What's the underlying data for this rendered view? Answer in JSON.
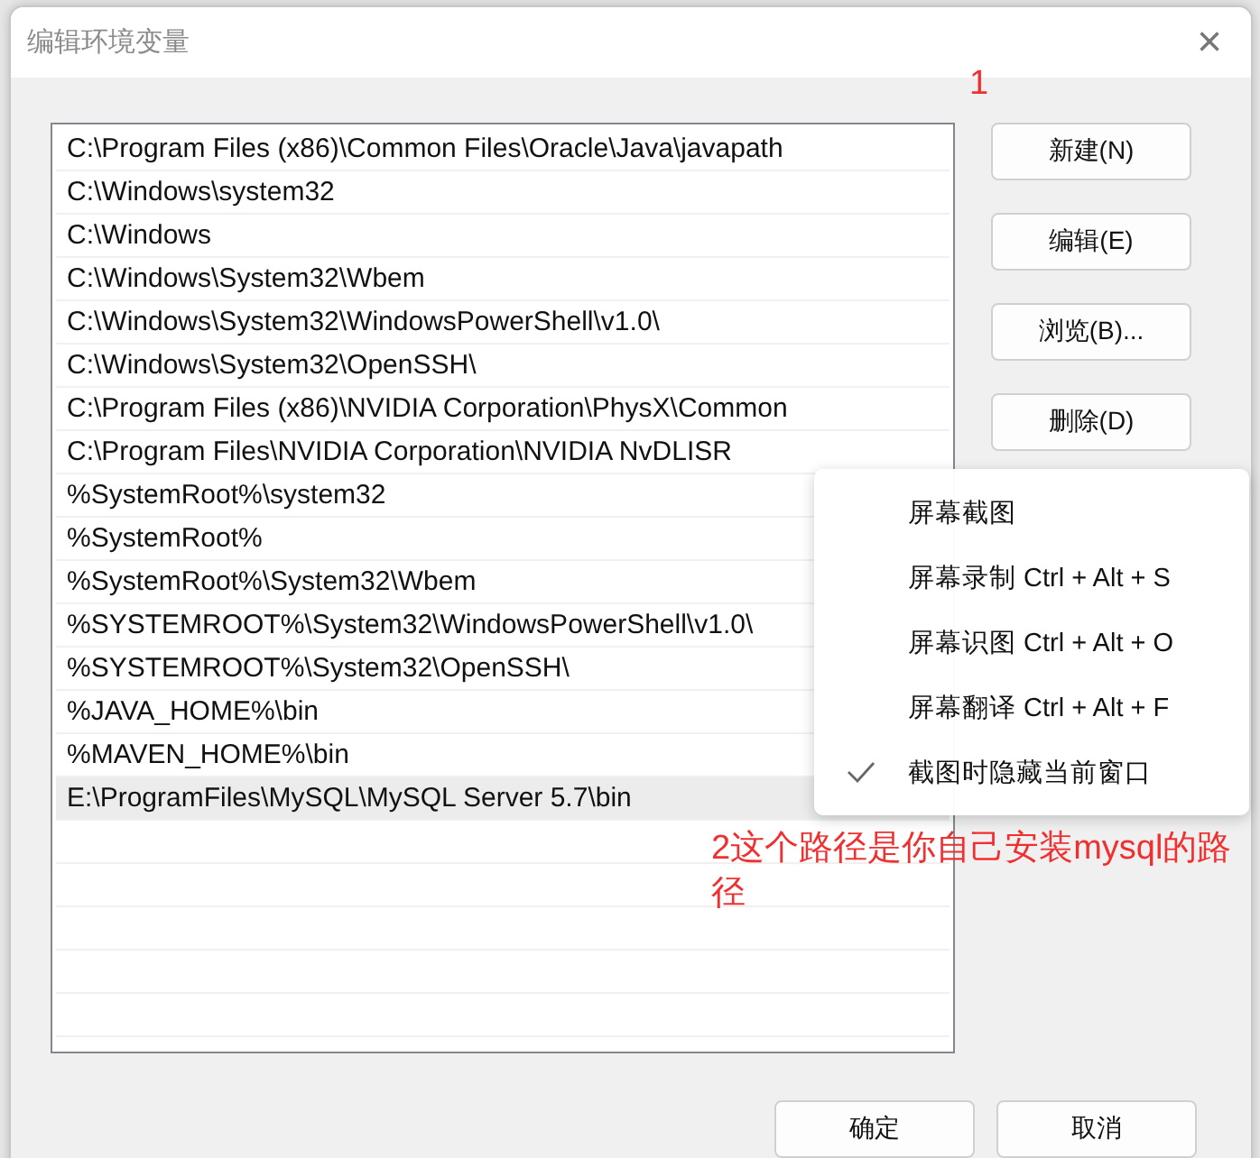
{
  "window": {
    "title": "编辑环境变量",
    "close": "×"
  },
  "paths": [
    {
      "text": "C:\\Program Files (x86)\\Common Files\\Oracle\\Java\\javapath",
      "selected": false
    },
    {
      "text": "C:\\Windows\\system32",
      "selected": false
    },
    {
      "text": "C:\\Windows",
      "selected": false
    },
    {
      "text": "C:\\Windows\\System32\\Wbem",
      "selected": false
    },
    {
      "text": "C:\\Windows\\System32\\WindowsPowerShell\\v1.0\\",
      "selected": false
    },
    {
      "text": "C:\\Windows\\System32\\OpenSSH\\",
      "selected": false
    },
    {
      "text": "C:\\Program Files (x86)\\NVIDIA Corporation\\PhysX\\Common",
      "selected": false
    },
    {
      "text": "C:\\Program Files\\NVIDIA Corporation\\NVIDIA NvDLISR",
      "selected": false
    },
    {
      "text": "%SystemRoot%\\system32",
      "selected": false
    },
    {
      "text": "%SystemRoot%",
      "selected": false
    },
    {
      "text": "%SystemRoot%\\System32\\Wbem",
      "selected": false
    },
    {
      "text": "%SYSTEMROOT%\\System32\\WindowsPowerShell\\v1.0\\",
      "selected": false
    },
    {
      "text": "%SYSTEMROOT%\\System32\\OpenSSH\\",
      "selected": false
    },
    {
      "text": "%JAVA_HOME%\\bin",
      "selected": false
    },
    {
      "text": "%MAVEN_HOME%\\bin",
      "selected": false
    },
    {
      "text": "E:\\ProgramFiles\\MySQL\\MySQL Server 5.7\\bin",
      "selected": true
    }
  ],
  "side_buttons": [
    "新建(N)",
    "编辑(E)",
    "浏览(B)...",
    "删除(D)"
  ],
  "bottom_buttons": [
    "确定",
    "取消"
  ],
  "context_menu": [
    {
      "label": "屏幕截图",
      "checked": false
    },
    {
      "label": "屏幕录制 Ctrl + Alt + S",
      "checked": false
    },
    {
      "label": "屏幕识图 Ctrl + Alt + O",
      "checked": false
    },
    {
      "label": "屏幕翻译 Ctrl + Alt + F",
      "checked": false
    },
    {
      "label": "截图时隐藏当前窗口",
      "checked": true
    }
  ],
  "annotations": [
    "1",
    "2这个路径是你自己安装mysql的路径"
  ]
}
